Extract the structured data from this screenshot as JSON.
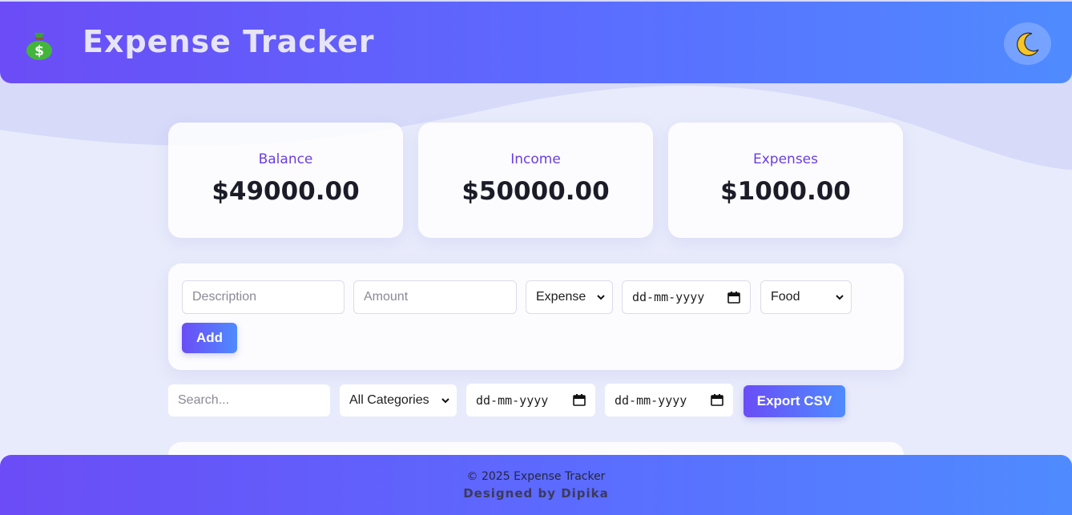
{
  "header": {
    "title": "Expense Tracker",
    "logo_icon": "money-bag-icon",
    "theme_toggle_icon": "moon-icon"
  },
  "summary": {
    "balance": {
      "label": "Balance",
      "value": "$49000.00"
    },
    "income": {
      "label": "Income",
      "value": "$50000.00"
    },
    "expenses": {
      "label": "Expenses",
      "value": "$1000.00"
    }
  },
  "form": {
    "description_placeholder": "Description",
    "amount_placeholder": "Amount",
    "type_selected": "Expense",
    "date_placeholder": "dd-mm-yyyy",
    "category_selected": "Food",
    "add_label": "Add"
  },
  "filters": {
    "search_placeholder": "Search...",
    "category_selected": "All Categories",
    "from_date_placeholder": "dd-mm-yyyy",
    "to_date_placeholder": "dd-mm-yyyy",
    "export_label": "Export CSV"
  },
  "footer": {
    "copyright": "© 2025 Expense Tracker",
    "credit": "Designed by Dipika"
  },
  "colors": {
    "accent_start": "#6b4cf6",
    "accent_end": "#4f8bff",
    "label_purple": "#6a3fe0",
    "background": "#e8ebfb"
  }
}
